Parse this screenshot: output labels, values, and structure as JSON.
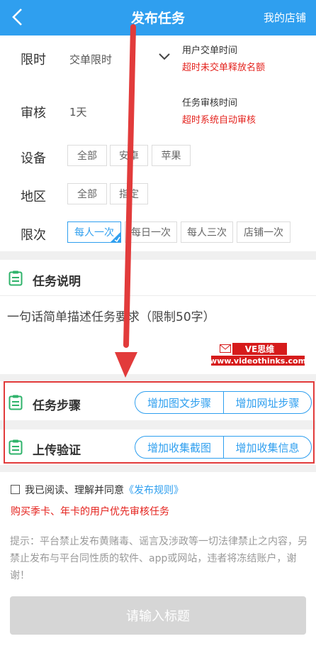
{
  "header": {
    "title": "发布任务",
    "right_link": "我的店铺"
  },
  "form": {
    "time_limit": {
      "label": "限时",
      "value": "交单限时",
      "hint_title": "用户交单时间",
      "hint_note": "超时未交单释放名额"
    },
    "review": {
      "label": "审核",
      "value": "1天",
      "hint_title": "任务审核时间",
      "hint_note": "超时系统自动审核"
    },
    "device": {
      "label": "设备",
      "options": [
        "全部",
        "安卓",
        "苹果"
      ]
    },
    "region": {
      "label": "地区",
      "options": [
        "全部",
        "指定"
      ]
    },
    "frequency": {
      "label": "限次",
      "options": [
        "每人一次",
        "每日一次",
        "每人三次",
        "店铺一次"
      ],
      "selected": "每人一次"
    }
  },
  "description": {
    "title": "任务说明",
    "placeholder": "一句话简单描述任务要求（限制50字）"
  },
  "steps": {
    "title": "任务步骤",
    "buttons": [
      "增加图文步骤",
      "增加网址步骤"
    ]
  },
  "verify": {
    "title": "上传验证",
    "buttons": [
      "增加收集截图",
      "增加收集信息"
    ]
  },
  "agreement": {
    "text": "我已阅读、理解并同意",
    "link": "《发布规则》",
    "checked": false
  },
  "promo": "购买季卡、年卡的用户优先审核任务",
  "notice": "提示：平台禁止发布黄赌毒、谣言及涉政等一切法律禁止之内容，另禁止发布与平台同性质的软件、app或网站，违者将冻结账户，谢谢！",
  "submit_label": "请输入标题",
  "watermark": {
    "brand": "VE思维",
    "url": "www.videothinks.com"
  },
  "colors": {
    "primary": "#2f9fef",
    "highlight_red": "#e4231e",
    "annotation_red": "#e23b3b",
    "icon_green": "#2fb36b"
  }
}
